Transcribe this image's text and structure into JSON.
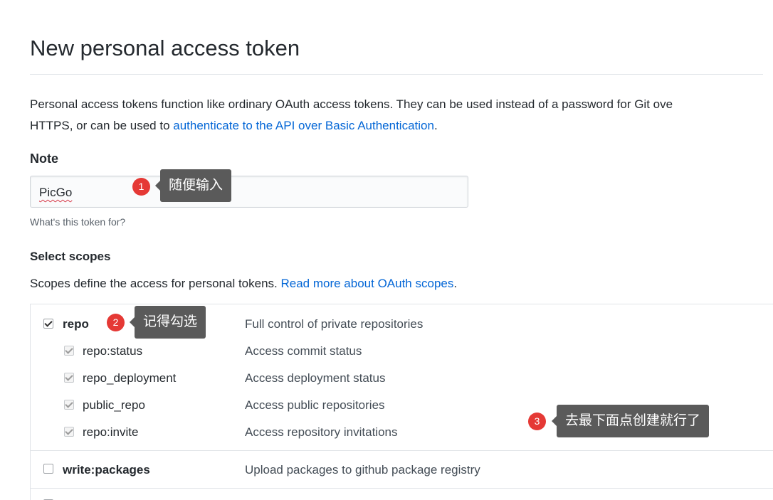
{
  "page": {
    "title": "New personal access token",
    "intro_line1": "Personal access tokens function like ordinary OAuth access tokens. They can be used instead of a password for Git ove",
    "intro_line2_prefix": "HTTPS, or can be used to ",
    "intro_link": "authenticate to the API over Basic Authentication",
    "intro_line2_suffix": "."
  },
  "note": {
    "label": "Note",
    "value": "PicGo",
    "hint": "What's this token for?"
  },
  "scopes": {
    "label": "Select scopes",
    "desc_prefix": "Scopes define the access for personal tokens. ",
    "desc_link": "Read more about OAuth scopes",
    "desc_suffix": ".",
    "rows": [
      {
        "name": "repo",
        "desc": "Full control of private repositories",
        "checked": true
      },
      {
        "name": "repo:status",
        "desc": "Access commit status",
        "checked": true
      },
      {
        "name": "repo_deployment",
        "desc": "Access deployment status",
        "checked": true
      },
      {
        "name": "public_repo",
        "desc": "Access public repositories",
        "checked": true
      },
      {
        "name": "repo:invite",
        "desc": "Access repository invitations",
        "checked": true
      },
      {
        "name": "write:packages",
        "desc": "Upload packages to github package registry",
        "checked": false
      }
    ]
  },
  "annotations": [
    {
      "number": "1",
      "text": "随便输入"
    },
    {
      "number": "2",
      "text": "记得勾选"
    },
    {
      "number": "3",
      "text": "去最下面点创建就行了"
    }
  ],
  "colors": {
    "link": "#0366d6",
    "badge": "#e53935",
    "callout": "#5a5a5a"
  }
}
